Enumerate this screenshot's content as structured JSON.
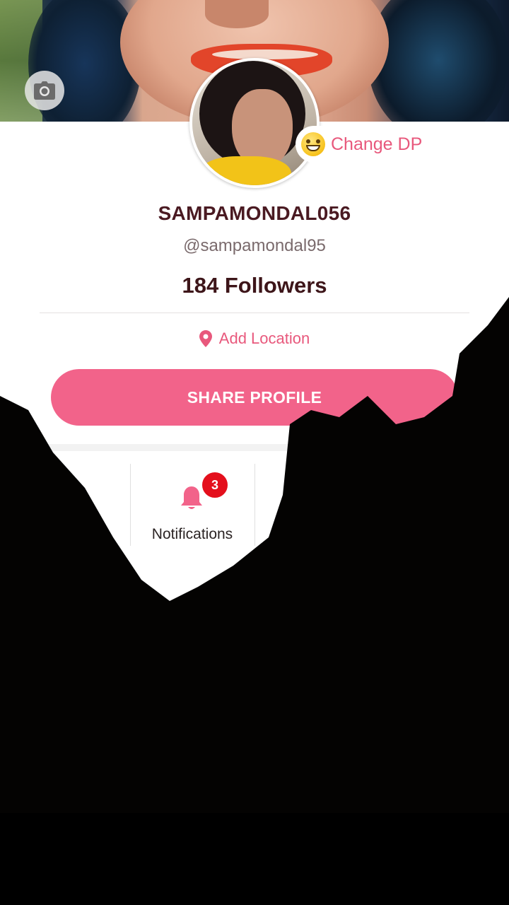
{
  "profile": {
    "change_dp_label": "Change DP",
    "username": "SAMPAMONDAL056",
    "handle": "@sampamondal95",
    "followers": "184 Followers",
    "location_label": "Add Location",
    "share_label": "SHARE PROFILE"
  },
  "quick_actions": [
    {
      "label": "",
      "icon": "camera-icon"
    },
    {
      "label": "Notifications",
      "icon": "bell-icon",
      "badge": "3"
    },
    {
      "label": "",
      "icon": "more-icon"
    }
  ],
  "colors": {
    "accent": "#f2638a",
    "link": "#e8587c",
    "username": "#4a1a22",
    "badge": "#e40f1c"
  }
}
